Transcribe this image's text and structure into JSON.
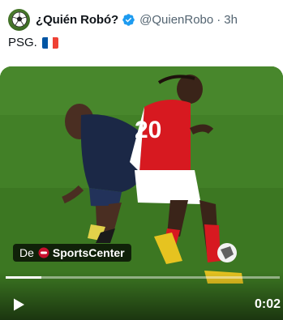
{
  "tweet": {
    "display_name": "¿Quién Robó?",
    "handle": "@QuienRobo",
    "separator": "·",
    "time": "3h",
    "text": "PSG.",
    "avatar_icon": "soccer-ball-icon",
    "verified_icon": "verified-badge-icon",
    "flag_icon": "france-flag-icon"
  },
  "video": {
    "source_prefix": "De",
    "source_name": "SportsCenter",
    "duration": "0:02",
    "progress": 0.13,
    "play_icon": "play-icon",
    "jersey_number": "20"
  },
  "colors": {
    "verified_blue": "#1d9bf0",
    "secondary_text": "#536471",
    "pitch_green": "#3f7b22",
    "arsenal_red": "#d71920",
    "psg_navy": "#1b2846"
  }
}
